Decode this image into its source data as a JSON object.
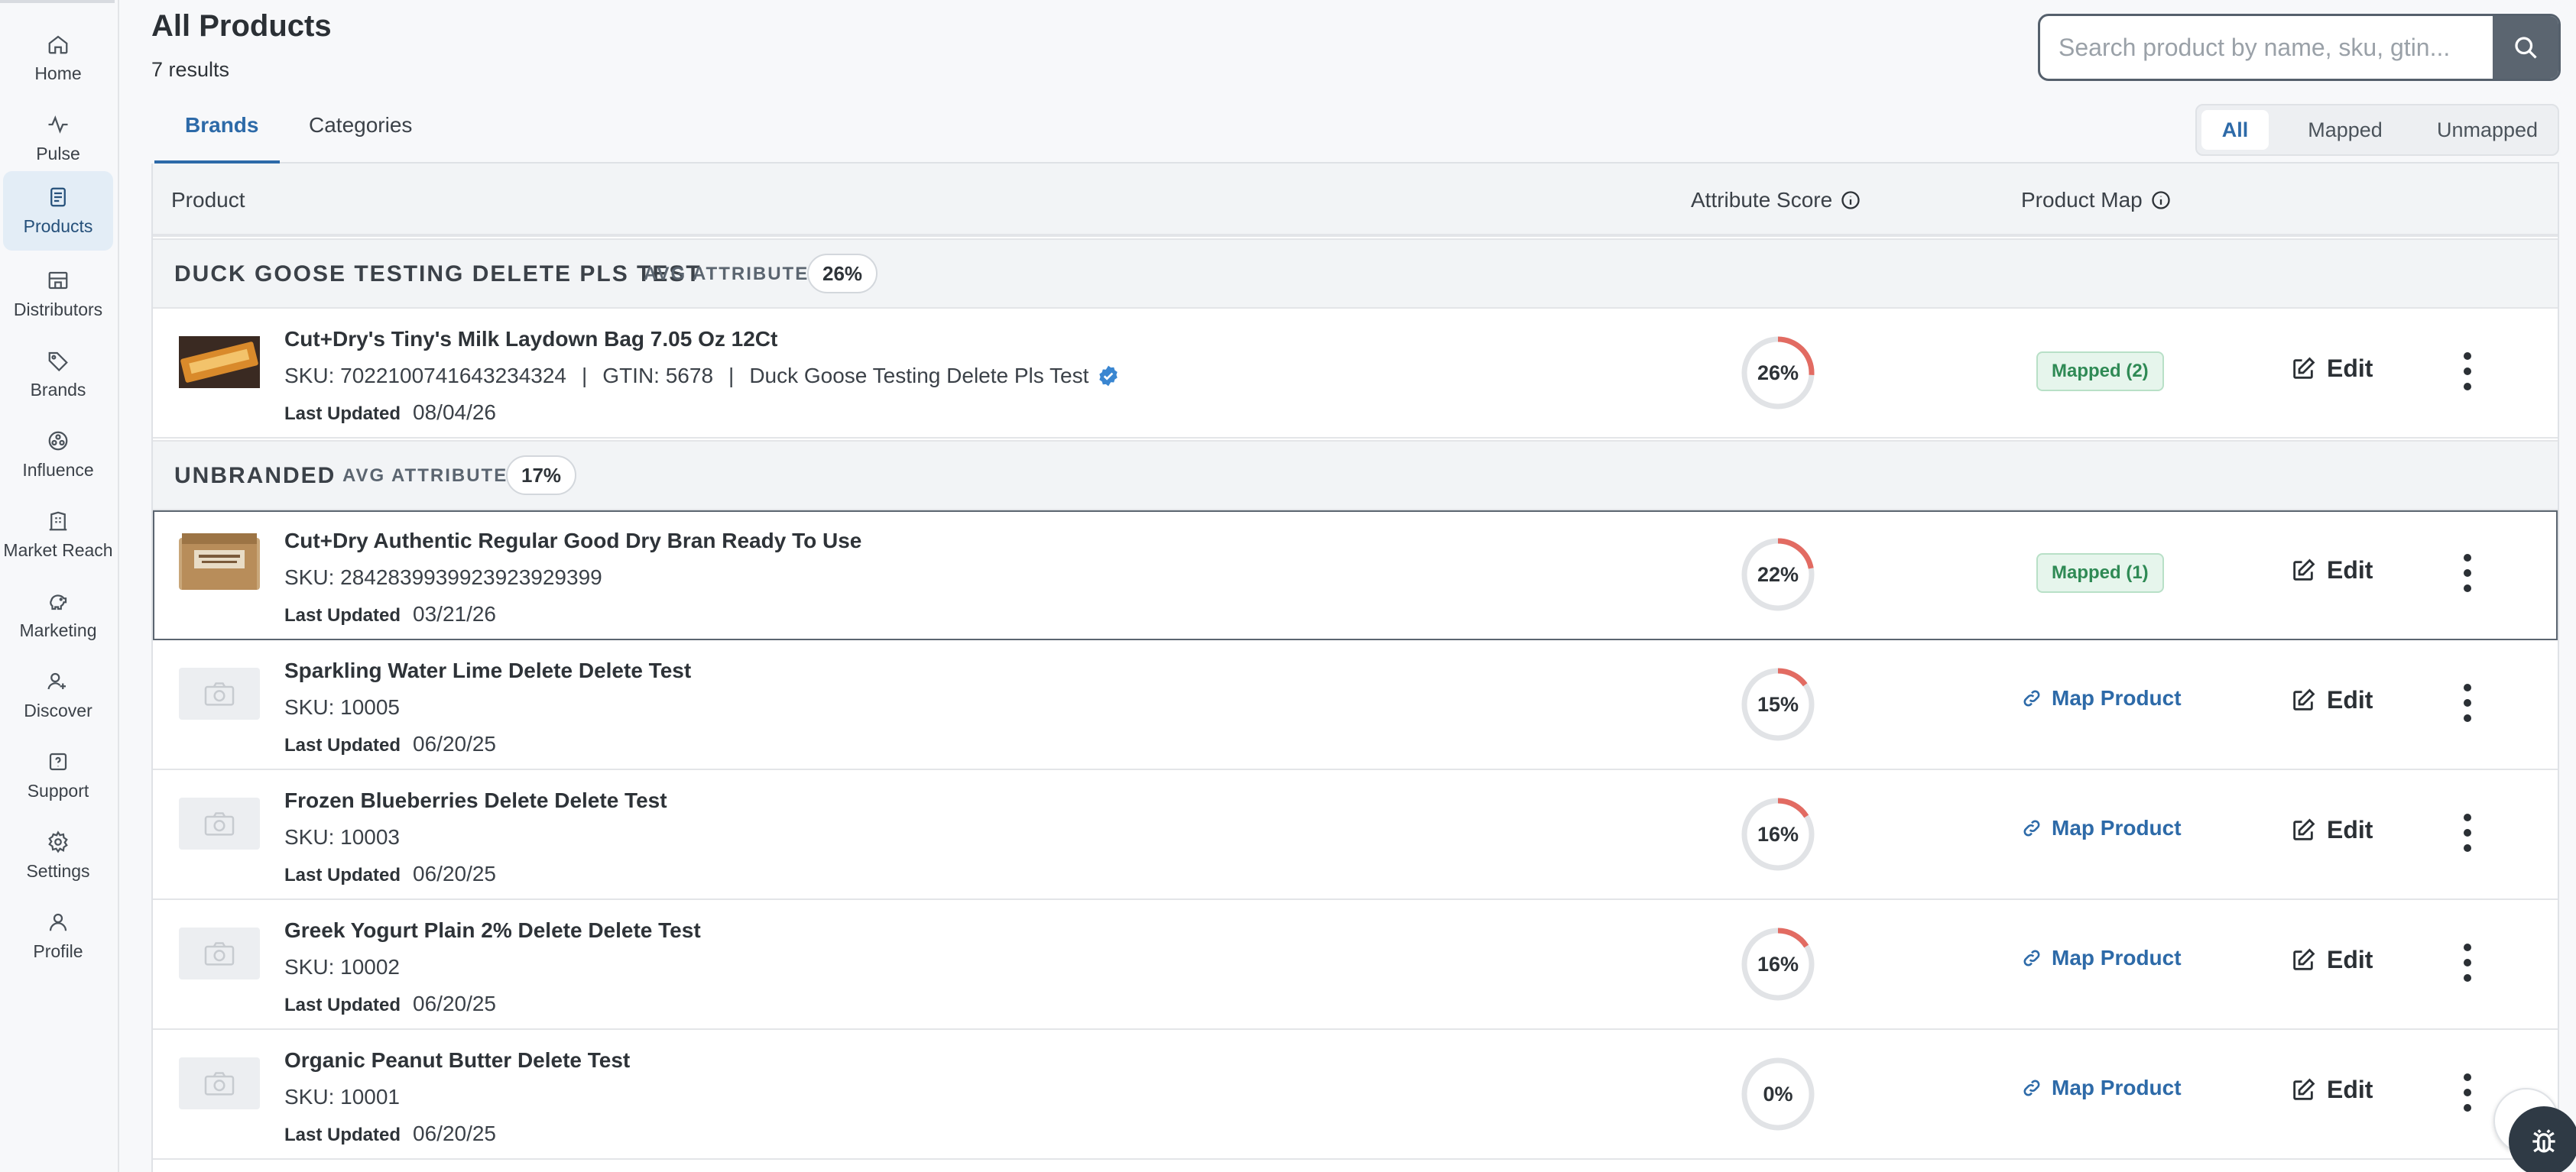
{
  "sidebar": {
    "items": [
      {
        "label": "Home",
        "icon": "home-icon"
      },
      {
        "label": "Pulse",
        "icon": "pulse-icon"
      },
      {
        "label": "Products",
        "icon": "products-icon",
        "active": true
      },
      {
        "label": "Distributors",
        "icon": "distributors-icon"
      },
      {
        "label": "Brands",
        "icon": "tag-icon"
      },
      {
        "label": "Influence",
        "icon": "influence-icon"
      },
      {
        "label": "Market Reach",
        "icon": "market-reach-icon"
      },
      {
        "label": "Marketing",
        "icon": "piggy-bank-icon"
      },
      {
        "label": "Discover",
        "icon": "discover-icon"
      },
      {
        "label": "Support",
        "icon": "support-icon"
      },
      {
        "label": "Settings",
        "icon": "gear-icon"
      },
      {
        "label": "Profile",
        "icon": "user-icon"
      }
    ]
  },
  "header": {
    "title": "All Products",
    "results": "7 results"
  },
  "search": {
    "placeholder": "Search product by name, sku, gtin...",
    "value": ""
  },
  "tabs": [
    {
      "label": "Brands",
      "active": true
    },
    {
      "label": "Categories",
      "active": false
    }
  ],
  "filter": {
    "options": [
      "All",
      "Mapped",
      "Unmapped"
    ],
    "selected": "All"
  },
  "table": {
    "columns": {
      "product": "Product",
      "attribute_score": "Attribute Score",
      "product_map": "Product Map"
    },
    "avg_label": "AVG ATTRIBUTE",
    "last_updated_label": "Last Updated",
    "edit_label": "Edit",
    "map_label": "Map Product",
    "groups": [
      {
        "name": "DUCK GOOSE TESTING DELETE PLS TEST",
        "avg": "26%",
        "products": [
          {
            "name": "Cut+Dry's Tiny's Milk Laydown Bag 7.05 Oz 12Ct",
            "sku": "SKU: 7022100741643234324",
            "gtin": "GTIN: 5678",
            "brand": "Duck Goose Testing Delete Pls Test",
            "updated": "08/04/26",
            "score": "26%",
            "score_value": 26,
            "map": "Mapped (2)",
            "thumb": "candy-bar"
          }
        ]
      },
      {
        "name": "UNBRANDED",
        "avg": "17%",
        "products": [
          {
            "name": "Cut+Dry Authentic Regular Good Dry Bran Ready To Use",
            "sku": "SKU: 2842839939923923929399",
            "updated": "03/21/26",
            "score": "22%",
            "score_value": 22,
            "map": "Mapped (1)",
            "thumb": "box"
          },
          {
            "name": "Sparkling Water Lime Delete Delete Test",
            "sku": "SKU: 10005",
            "updated": "06/20/25",
            "score": "15%",
            "score_value": 15,
            "map": null,
            "thumb": "placeholder"
          },
          {
            "name": "Frozen Blueberries Delete Delete Test",
            "sku": "SKU: 10003",
            "updated": "06/20/25",
            "score": "16%",
            "score_value": 16,
            "map": null,
            "thumb": "placeholder"
          },
          {
            "name": "Greek Yogurt Plain 2% Delete Delete Test",
            "sku": "SKU: 10002",
            "updated": "06/20/25",
            "score": "16%",
            "score_value": 16,
            "map": null,
            "thumb": "placeholder"
          },
          {
            "name": "Organic Peanut Butter Delete Test",
            "sku": "SKU: 10001",
            "updated": "06/20/25",
            "score": "0%",
            "score_value": 0,
            "map": null,
            "thumb": "placeholder"
          }
        ]
      }
    ]
  },
  "colors": {
    "accent": "#2d6aa8",
    "score_ring": "#e26b62",
    "score_track": "#e1e3e6",
    "mapped_bg": "#e6f5ec",
    "mapped_text": "#2f8a55"
  }
}
